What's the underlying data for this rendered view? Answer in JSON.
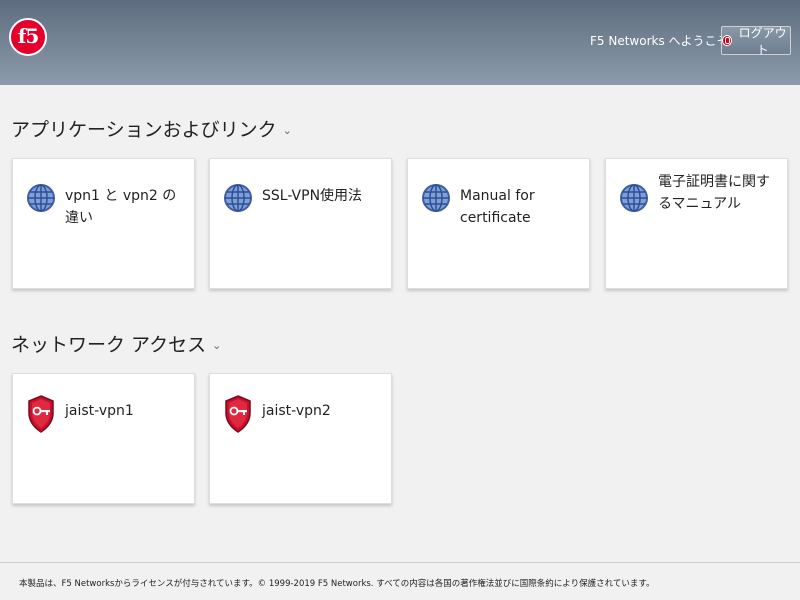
{
  "header": {
    "logo_text": "f5",
    "welcome": "F5 Networks へようこそ",
    "logout_label": "ログアウト"
  },
  "sections": [
    {
      "title": "アプリケーションおよびリンク",
      "tiles": [
        {
          "label": "vpn1 と vpn2 の違い",
          "icon": "globe-icon"
        },
        {
          "label": "SSL-VPN使用法",
          "icon": "globe-icon"
        },
        {
          "label": "Manual for certificate",
          "icon": "globe-icon"
        },
        {
          "label": "電子証明書に関するマニュアル",
          "icon": "globe-icon"
        }
      ]
    },
    {
      "title": "ネットワーク アクセス",
      "tiles": [
        {
          "label": "jaist-vpn1",
          "icon": "shield-key-icon"
        },
        {
          "label": "jaist-vpn2",
          "icon": "shield-key-icon"
        }
      ]
    }
  ],
  "footer": "本製品は、F5 Networksからライセンスが付与されています。© 1999-2019 F5 Networks. すべての内容は各国の著作権法並びに国際条約により保護されています。",
  "colors": {
    "brand_red": "#e4002b",
    "header_top": "#5d6d7f",
    "globe_blue": "#4a6fb5"
  }
}
